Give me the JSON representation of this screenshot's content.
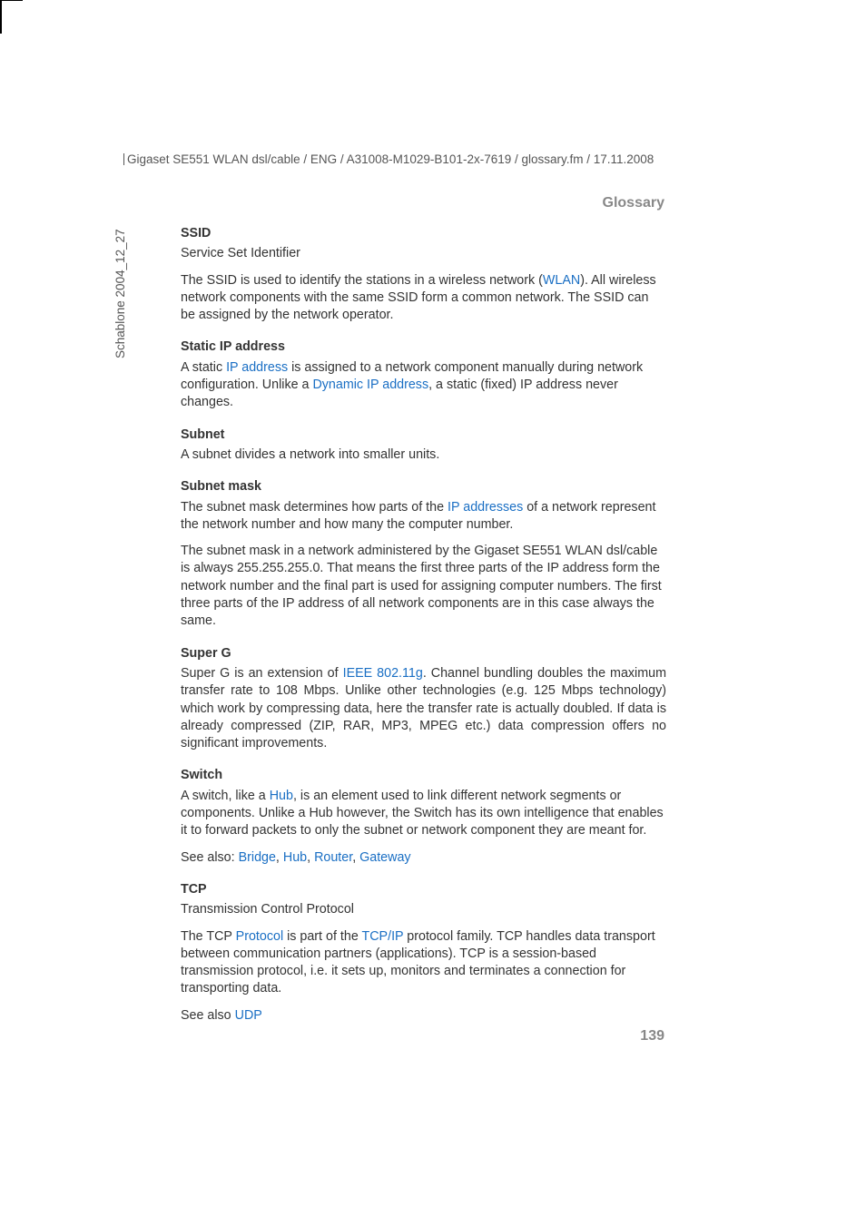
{
  "header": {
    "path": "Gigaset SE551 WLAN dsl/cable / ENG / A31008-M1029-B101-2x-7619 / glossary.fm / 17.11.2008"
  },
  "sidebar": {
    "template": "Schablone 2004_12_27"
  },
  "section_title": "Glossary",
  "page_number": "139",
  "entries": {
    "ssid": {
      "term": "SSID",
      "sub": "Service Set Identifier",
      "body1a": "The SSID is used to identify the stations in a wireless network (",
      "link1": "WLAN",
      "body1b": "). All wireless network components with the same SSID form a common network. The SSID can be assigned by the network operator."
    },
    "static_ip": {
      "term": "Static IP address",
      "body1a": "A static ",
      "link1": "IP address",
      "body1b": " is assigned to a network component manually during network configuration. Unlike a ",
      "link2": "Dynamic IP address",
      "body1c": ", a static (fixed) IP address never changes."
    },
    "subnet": {
      "term": "Subnet",
      "body": "A subnet divides a network into smaller units."
    },
    "subnet_mask": {
      "term": "Subnet mask",
      "body1a": "The subnet mask determines how parts of the ",
      "link1": "IP addresses",
      "body1b": " of a network represent the network number and how many the computer number.",
      "body2": "The subnet mask in a network administered by the Gigaset SE551 WLAN dsl/cable is always 255.255.255.0. That means the first three parts of the IP address form the network number and the final part is used for assigning computer numbers. The first three parts of the IP address of all network components are in this case always the same."
    },
    "super_g": {
      "term": "Super G",
      "body1a": "Super G is an extension of ",
      "link1": "IEEE 802.11g",
      "body1b": ". Channel bundling doubles the maximum transfer rate to 108 Mbps. Unlike other technologies (e.g. 125 Mbps technology) which work by compressing data, here the transfer rate is actually doubled. If data is already compressed (ZIP, RAR, MP3, MPEG etc.) data compression offers no significant improvements."
    },
    "switch": {
      "term": "Switch",
      "body1a": "A switch, like a ",
      "link1": "Hub",
      "body1b": ", is an element used to link different network segments or components. Unlike a Hub however, the Switch has its own intelligence that enables it to forward packets to only the subnet or network component they are meant for.",
      "seealso_prefix": "See also: ",
      "sa1": "Bridge",
      "comma": ", ",
      "sa2": "Hub",
      "sa3": "Router",
      "sa4": "Gateway"
    },
    "tcp": {
      "term": "TCP",
      "sub": "Transmission Control Protocol",
      "body1a": "The TCP ",
      "link1": "Protocol",
      "body1b": " is part of the ",
      "link2": "TCP/IP",
      "body1c": " protocol family. TCP handles data transport between communication partners (applications). TCP is a session-based transmission protocol, i.e. it sets up, monitors and terminates a connection for transporting data.",
      "seealso_prefix": "See also ",
      "sa1": "UDP"
    }
  }
}
